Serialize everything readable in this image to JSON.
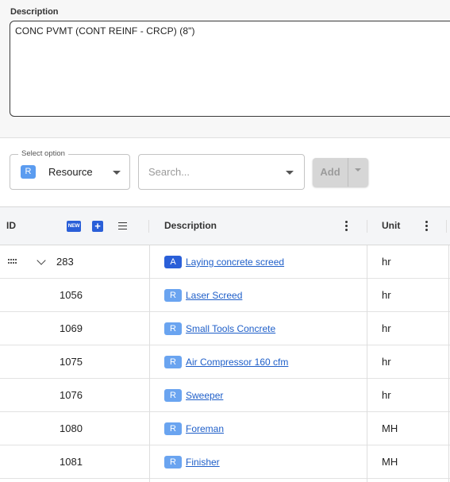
{
  "description": {
    "label": "Description",
    "value": "CONC PVMT (CONT REINF - CRCP) (8\")"
  },
  "toolbar": {
    "select_legend": "Select option",
    "select_badge": "R",
    "select_value": "Resource",
    "search_placeholder": "Search...",
    "add_label": "Add"
  },
  "grid": {
    "headers": {
      "id": "ID",
      "new_badge": "NEW",
      "plus": "+",
      "description": "Description",
      "unit": "Unit"
    },
    "rows": [
      {
        "id": "283",
        "type": "A",
        "description": "Laying concrete screed",
        "unit": "hr",
        "expandable": true
      },
      {
        "id": "1056",
        "type": "R",
        "description": "Laser Screed",
        "unit": "hr"
      },
      {
        "id": "1069",
        "type": "R",
        "description": "Small Tools Concrete",
        "unit": "hr"
      },
      {
        "id": "1075",
        "type": "R",
        "description": "Air Compressor 160 cfm",
        "unit": "hr"
      },
      {
        "id": "1076",
        "type": "R",
        "description": "Sweeper",
        "unit": "hr"
      },
      {
        "id": "1080",
        "type": "R",
        "description": "Foreman",
        "unit": "MH"
      },
      {
        "id": "1081",
        "type": "R",
        "description": "Finisher",
        "unit": "MH"
      }
    ]
  },
  "colors": {
    "accent": "#2a5fd8",
    "resource_badge": "#6aa4f0",
    "link": "#1f5fc9"
  }
}
